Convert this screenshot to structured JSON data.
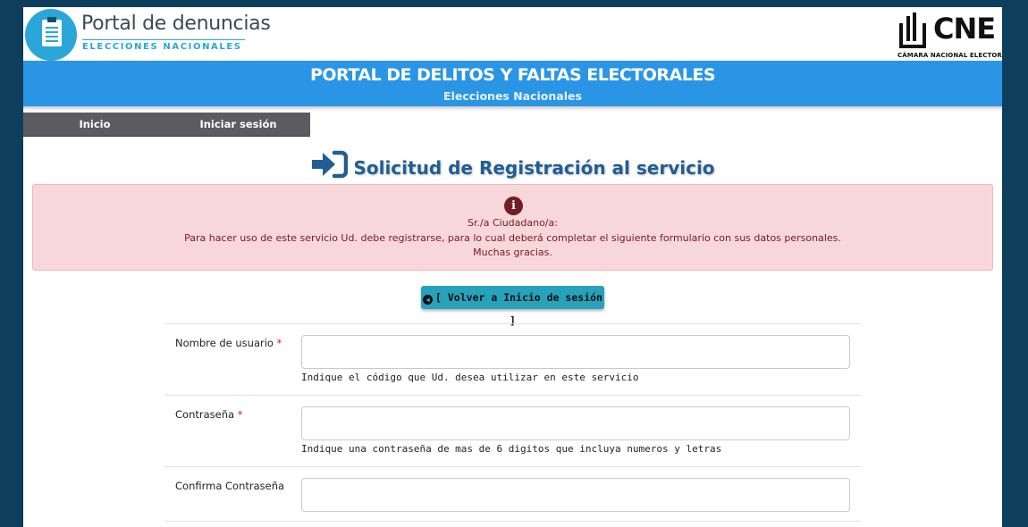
{
  "header": {
    "brand_title": "Portal de denuncias",
    "brand_subtitle": "ELECCIONES NACIONALES",
    "cne_logo": "CNE",
    "cne_subtitle": "CÁMARA NACIONAL ELECTORAL"
  },
  "banner": {
    "title": "PORTAL DE DELITOS Y FALTAS ELECTORALES",
    "subtitle": "Elecciones Nacionales"
  },
  "nav": {
    "items": [
      {
        "label": "Inicio"
      },
      {
        "label": "Iniciar sesión"
      }
    ]
  },
  "page": {
    "title": "Solicitud de Registración al servicio",
    "title_icon": "sign-in-icon"
  },
  "alert": {
    "icon": "info-icon",
    "icon_glyph": "i",
    "line1": "Sr./a Ciudadano/a:",
    "line2": "Para hacer uso de este servicio Ud. debe registrarse, para lo cual deberá completar el siguiente formulario con sus datos personales.",
    "line3": "Muchas gracias."
  },
  "back_button": {
    "label": "[ Volver a Inicio de sesión ]",
    "icon": "arrow-left-circle-icon"
  },
  "form": {
    "username": {
      "label": "Nombre de usuario",
      "required": "*",
      "value": "",
      "help": "Indique el código que Ud. desea utilizar en este servicio"
    },
    "password": {
      "label": "Contraseña",
      "required": "*",
      "value": "",
      "help": "Indique una contraseña de mas de 6 digitos que incluya numeros y letras"
    },
    "confirm_password": {
      "label": "Confirma Contraseña",
      "value": ""
    }
  },
  "colors": {
    "background": "#0d3e5c",
    "banner": "#2b95e5",
    "nav": "#5b5b60",
    "heading": "#215e92",
    "alert_bg": "#f8d7da",
    "alert_text": "#721c24",
    "button": "#27a2ba",
    "required": "#cc1f1f"
  }
}
